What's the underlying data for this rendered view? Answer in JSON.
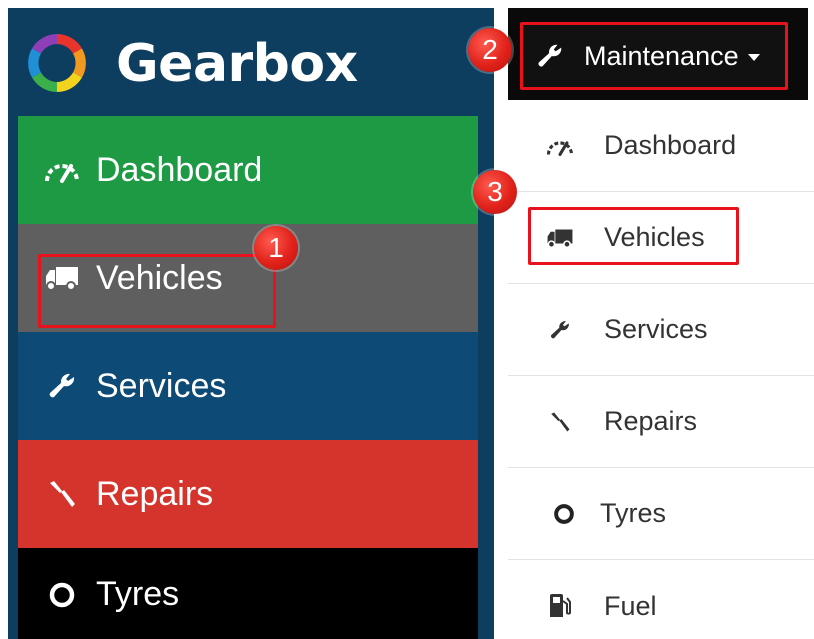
{
  "brand": {
    "name": "Gearbox"
  },
  "sidebar": {
    "items": [
      {
        "label": "Dashboard",
        "icon": "dashboard-gauge-icon",
        "color": "#1d9a43"
      },
      {
        "label": "Vehicles",
        "icon": "truck-icon",
        "color": "#5f5f5f"
      },
      {
        "label": "Services",
        "icon": "wrench-icon",
        "color": "#0d4a75"
      },
      {
        "label": "Repairs",
        "icon": "screwdriver-icon",
        "color": "#d4342c"
      },
      {
        "label": "Tyres",
        "icon": "tyre-ring-icon",
        "color": "#000000"
      }
    ]
  },
  "topnav": {
    "menu_label": "Maintenance",
    "menu_icon": "wrench-icon",
    "dropdown": [
      {
        "label": "Dashboard",
        "icon": "dashboard-gauge-icon"
      },
      {
        "label": "Vehicles",
        "icon": "truck-icon"
      },
      {
        "label": "Services",
        "icon": "wrench-icon"
      },
      {
        "label": "Repairs",
        "icon": "screwdriver-icon"
      },
      {
        "label": "Tyres",
        "icon": "tyre-ring-icon"
      },
      {
        "label": "Fuel",
        "icon": "fuel-pump-icon"
      }
    ]
  },
  "annotations": {
    "step1": "1",
    "step2": "2",
    "step3": "3",
    "highlight_color": "#e8121c"
  }
}
